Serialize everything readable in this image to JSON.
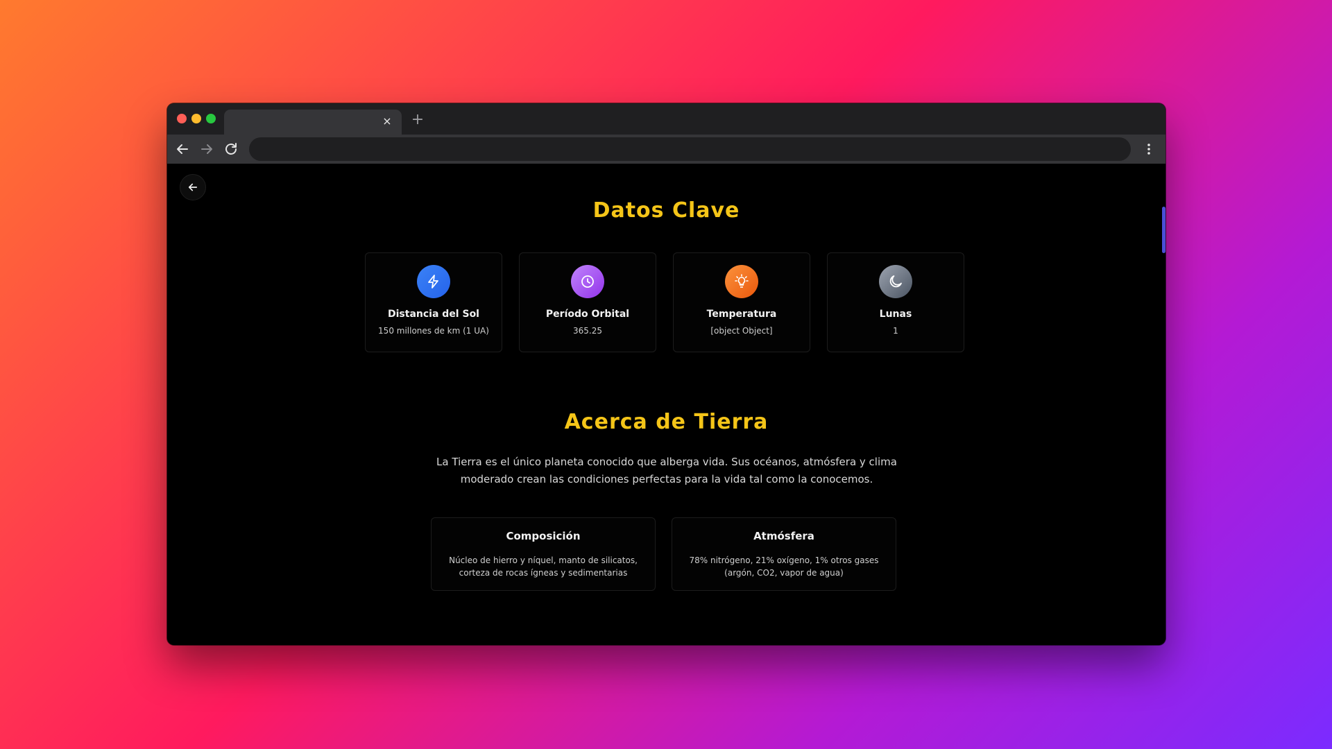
{
  "browser": {
    "tab_close_glyph": "×",
    "new_tab_glyph": "+",
    "icons": [
      "arrow-left-icon",
      "arrow-right-icon",
      "reload-icon",
      "more-vertical-icon",
      "close-icon",
      "plus-icon"
    ]
  },
  "page": {
    "back_icon": "arrow-left-icon",
    "key_facts": {
      "title": "Datos Clave",
      "cards": [
        {
          "label": "Distancia del Sol",
          "value": "150 millones de km (1 UA)",
          "icon": "lightning-icon",
          "color": "#3b82f6"
        },
        {
          "label": "Período Orbital",
          "value": "365.25",
          "icon": "clock-icon",
          "color": "#a855f7"
        },
        {
          "label": "Temperatura",
          "value": "[object Object]",
          "icon": "lightbulb-icon",
          "color": "#f97316"
        },
        {
          "label": "Lunas",
          "value": "1",
          "icon": "moon-icon",
          "color": "#6b7280"
        }
      ]
    },
    "about": {
      "title": "Acerca de Tierra",
      "text": "La Tierra es el único planeta conocido que alberga vida. Sus océanos, atmósfera y clima moderado crean las condiciones perfectas para la vida tal como la conocemos.",
      "cards": [
        {
          "title": "Composición",
          "text": "Núcleo de hierro y níquel, manto de silicatos, corteza de rocas ígneas y sedimentarias"
        },
        {
          "title": "Atmósfera",
          "text": "78% nitrógeno, 21% oxígeno, 1% otros gases (argón, CO2, vapor de agua)"
        }
      ]
    },
    "accent_color": "#f5c518"
  }
}
